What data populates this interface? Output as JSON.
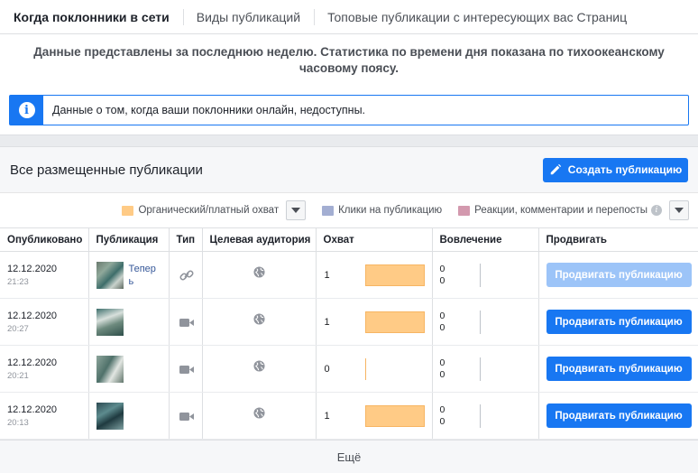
{
  "tabs": [
    {
      "label": "Когда поклонники в сети",
      "active": true
    },
    {
      "label": "Виды публикаций",
      "active": false
    },
    {
      "label": "Топовые публикации с интересующих вас Страниц",
      "active": false
    }
  ],
  "notice": "Данные представлены за последнюю неделю. Статистика по времени дня показана по тихоокеанскому часовому поясу.",
  "alert": {
    "icon": "info-icon",
    "text": "Данные о том, когда ваши поклонники онлайн, недоступны."
  },
  "posts": {
    "title": "Все размещенные публикации",
    "create_button": "Создать публикацию",
    "legend": {
      "reach": {
        "label": "Органический/платный охват",
        "color": "#ffcb86"
      },
      "clicks": {
        "label": "Клики на публикацию",
        "color": "#a3aed2"
      },
      "reactions": {
        "label": "Реакции, комментарии и перепосты",
        "color": "#d399ae"
      }
    },
    "columns": [
      "Опубликовано",
      "Публикация",
      "Тип",
      "Целевая аудитория",
      "Охват",
      "Вовлечение",
      "Продвигать"
    ],
    "rows": [
      {
        "date": "12.12.2020",
        "time": "21:23",
        "text": "Теперь",
        "type": "link-icon",
        "audience": "globe-icon",
        "reach": 1,
        "reach_fraction": 1.0,
        "engagement": [
          "0",
          "0"
        ],
        "promote": "Продвигать публикацию",
        "promote_enabled": false
      },
      {
        "date": "12.12.2020",
        "time": "20:27",
        "text": "",
        "type": "video-icon",
        "audience": "globe-icon",
        "reach": 1,
        "reach_fraction": 1.0,
        "engagement": [
          "0",
          "0"
        ],
        "promote": "Продвигать публикацию",
        "promote_enabled": true
      },
      {
        "date": "12.12.2020",
        "time": "20:21",
        "text": "",
        "type": "video-icon",
        "audience": "globe-icon",
        "reach": 0,
        "reach_fraction": 0.0,
        "engagement": [
          "0",
          "0"
        ],
        "promote": "Продвигать публикацию",
        "promote_enabled": true
      },
      {
        "date": "12.12.2020",
        "time": "20:13",
        "text": "",
        "type": "video-icon",
        "audience": "globe-icon",
        "reach": 1,
        "reach_fraction": 1.0,
        "engagement": [
          "0",
          "0"
        ],
        "promote": "Продвигать публикацию",
        "promote_enabled": true
      }
    ],
    "more": "Ещё"
  }
}
